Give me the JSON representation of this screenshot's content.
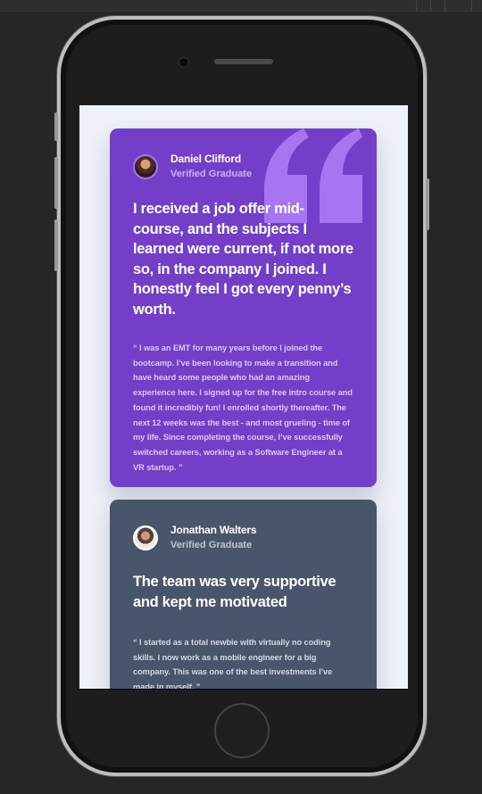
{
  "testimonials": [
    {
      "name": "Daniel Clifford",
      "role": "Verified Graduate",
      "headline": "I received a job offer mid-course, and the subjects I learned were current, if not more so, in the company I joined. I honestly feel I got every penny’s worth.",
      "body": "“ I was an EMT for many years before I joined the bootcamp. I’ve been looking to make a transition and have heard some people who had an amazing experience here. I signed up for the free intro course and found it incredibly fun! I enrolled shortly thereafter. The next 12 weeks was the best - and most grueling - time of my life. Since completing the course, I’ve successfully switched careers, working as a Software Engineer at a VR startup. ”",
      "card_color": "#733fc8"
    },
    {
      "name": "Jonathan Walters",
      "role": "Verified Graduate",
      "headline": "The team was very supportive and kept me motivated",
      "body": "“ I started as a total newbie with virtually no coding skills. I now work as a mobile engineer for a big company. This was one of the best investments I’ve made in myself. ”",
      "card_color": "#48556a"
    }
  ],
  "icons": {
    "quote": "quote-icon",
    "camera": "front-camera-icon",
    "home": "home-button-icon"
  },
  "colors": {
    "background": "#262626",
    "screen": "#eef1f8",
    "violet": "#733fc8",
    "grayish_blue": "#48556a",
    "quote_accent": "#a775f1"
  }
}
